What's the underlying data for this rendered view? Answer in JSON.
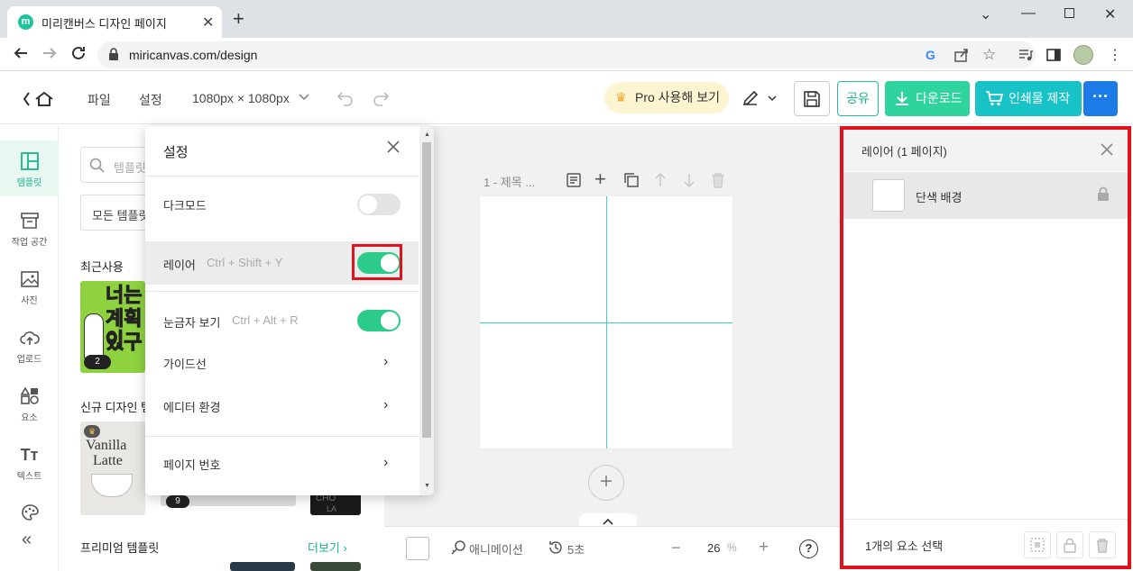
{
  "browser": {
    "tab_title": "미리캔버스 디자인 페이지",
    "favicon_letter": "m",
    "url": "miricanvas.com/design"
  },
  "header": {
    "file_menu": "파일",
    "settings_menu": "설정",
    "page_size": "1080px × 1080px",
    "pro_button": "Pro 사용해 보기",
    "share_button": "공유",
    "download_button": "다운로드",
    "print_button": "인쇄물 제작",
    "more_button": "···"
  },
  "rail": {
    "items": [
      {
        "label": "템플릿",
        "icon": "template-icon"
      },
      {
        "label": "작업 공간",
        "icon": "archive-icon"
      },
      {
        "label": "사진",
        "icon": "photo-icon"
      },
      {
        "label": "업로드",
        "icon": "upload-icon"
      },
      {
        "label": "요소",
        "icon": "shapes-icon"
      },
      {
        "label": "텍스트",
        "icon": "text-icon"
      },
      {
        "label": "",
        "icon": "palette-icon"
      }
    ],
    "collapse": "«"
  },
  "templates": {
    "search_placeholder": "템플릿",
    "filter_label": "모든 템플릿",
    "recent_title": "최근사용",
    "recent_badge": "2",
    "new_title": "신규 디자인 템",
    "new_badge": "9",
    "premium_title": "프리미엄 템플릿",
    "more_link": "더보기",
    "thumb1_lines": [
      "너는",
      "계획이",
      "있구"
    ],
    "thumb2_lines": [
      "Vanilla",
      "Latte"
    ],
    "thumb3_lines": [
      "CHO",
      "LA"
    ]
  },
  "settings": {
    "title": "설정",
    "items": [
      {
        "label": "다크모드",
        "shortcut": "",
        "toggle": "off"
      },
      {
        "label": "레이어",
        "shortcut": "Ctrl + Shift + Y",
        "toggle": "on"
      },
      {
        "label": "눈금자 보기",
        "shortcut": "Ctrl + Alt + R",
        "toggle": "on"
      },
      {
        "label": "가이드선",
        "shortcut": ""
      },
      {
        "label": "에디터 환경",
        "shortcut": ""
      },
      {
        "label": "페이지 번호",
        "shortcut": ""
      }
    ]
  },
  "canvas": {
    "page_label": "1 - 제목 ...",
    "animation_label": "애니메이션",
    "duration_label": "5초",
    "zoom_value": "26",
    "zoom_unit": "%",
    "help": "?"
  },
  "layers": {
    "title": "레이어 (1 페이지)",
    "rows": [
      {
        "label": "단색 배경"
      }
    ],
    "selection_text": "1개의 요소 선택"
  },
  "colors": {
    "accent_green": "#2dcb8b",
    "download": "#2ed39d",
    "print": "#18c3c7",
    "more": "#1d7be8",
    "highlight": "#e0121c",
    "guide": "#3dd3c7"
  }
}
